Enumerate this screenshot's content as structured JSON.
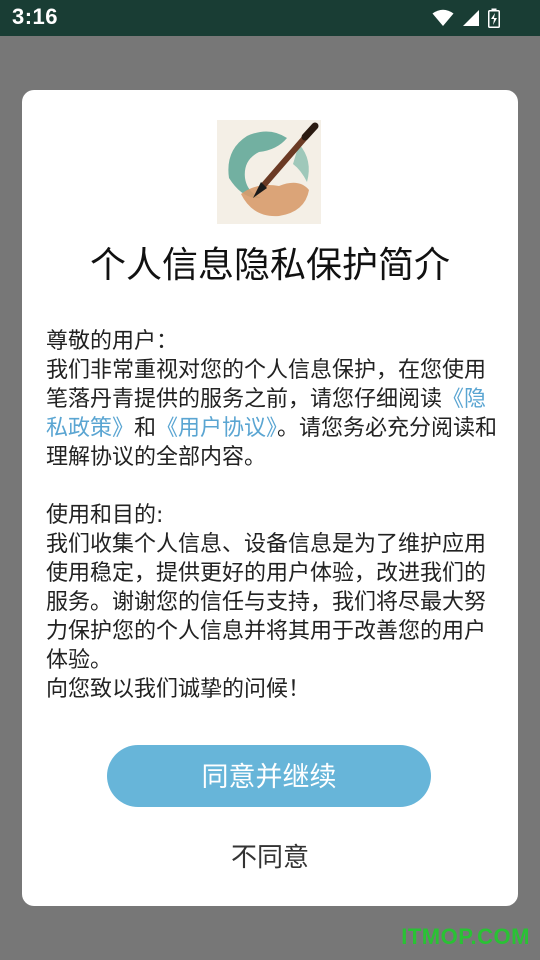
{
  "status_bar": {
    "time": "3:16",
    "icons": [
      "wifi-icon",
      "signal-icon",
      "battery-icon"
    ],
    "background": "#193d34"
  },
  "dialog": {
    "title": "个人信息隐私保护简介",
    "greeting": "尊敬的用户：",
    "intro_part1": "我们非常重视对您的个人信息保护，在您使用笔落丹青提供的服务之前，请您仔细阅读",
    "privacy_link": "《隐私政策》",
    "and_text": "和",
    "agreement_link": "《用户协议》",
    "intro_part2": "。请您务必充分阅读和理解协议的全部内容。",
    "usage_heading": "使用和目的:",
    "usage_text": "我们收集个人信息、设备信息是为了维护应用使用稳定，提供更好的用户体验，改进我们的服务。谢谢您的信任与支持，我们将尽最大努力保护您的个人信息并将其用于改善您的用户体验。",
    "regards": "向您致以我们诚挚的问候！",
    "agree_label": "同意并继续",
    "disagree_label": "不同意"
  },
  "colors": {
    "link": "#5aa5d2",
    "primary_button": "#67b5d9",
    "scrim": "#777777"
  },
  "watermark": "ITMOP.COM"
}
